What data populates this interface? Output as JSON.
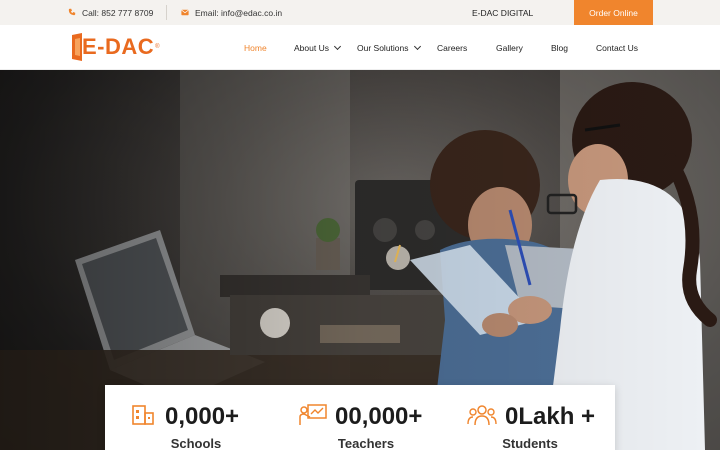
{
  "topbar": {
    "call": "Call: 852 777 8709",
    "email": "Email: info@edac.co.in",
    "digital": "E-DAC DIGITAL",
    "order": "Order Online"
  },
  "brand": {
    "name": "E-DAC"
  },
  "nav": [
    {
      "label": "Home",
      "active": true
    },
    {
      "label": "About Us"
    },
    {
      "label": "Our Solutions"
    },
    {
      "label": "Careers"
    },
    {
      "label": "Gallery"
    },
    {
      "label": "Blog"
    },
    {
      "label": "Contact Us"
    }
  ],
  "stats": [
    {
      "value": "0,000+",
      "label": "Schools",
      "icon": "school-icon"
    },
    {
      "value": "00,000+",
      "label": "Teachers",
      "icon": "teacher-icon"
    },
    {
      "value": "0Lakh +",
      "label": "Students",
      "icon": "students-icon"
    }
  ],
  "colors": {
    "accent": "#f0852d",
    "topbar_bg": "#f4f2ef"
  }
}
